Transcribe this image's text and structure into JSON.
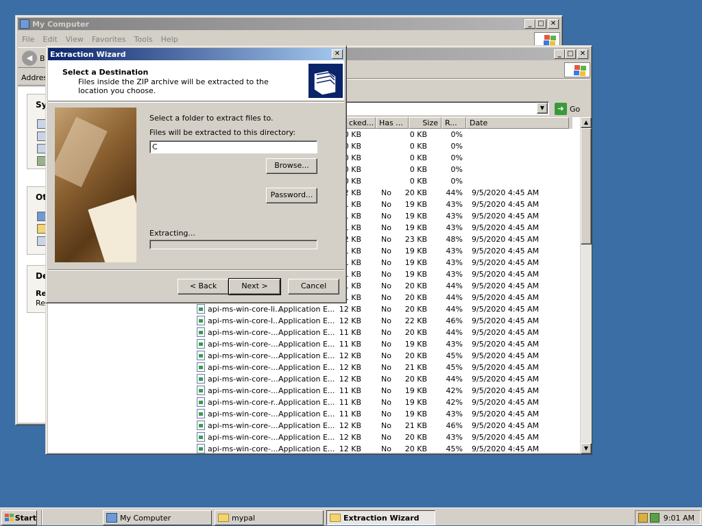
{
  "my_computer": {
    "title": "My Computer",
    "menu": [
      "File",
      "Edit",
      "View",
      "Favorites",
      "Tools",
      "Help"
    ],
    "back_label": "B",
    "address_label": "Addres",
    "panels": [
      {
        "title": "Sys"
      },
      {
        "title": "Oth"
      },
      {
        "title": "De",
        "detail_title": "Re",
        "detail_text": "Re"
      }
    ]
  },
  "zip_window": {
    "go_label": "Go",
    "columns": [
      "cked...",
      "Has ...",
      "Size",
      "R...",
      "Date"
    ],
    "rows": [
      {
        "name": "",
        "type": "",
        "packed": "0 KB",
        "pw": "",
        "size": "0 KB",
        "ratio": "0%",
        "date": ""
      },
      {
        "name": "",
        "type": "",
        "packed": "0 KB",
        "pw": "",
        "size": "0 KB",
        "ratio": "0%",
        "date": ""
      },
      {
        "name": "",
        "type": "",
        "packed": "0 KB",
        "pw": "",
        "size": "0 KB",
        "ratio": "0%",
        "date": ""
      },
      {
        "name": "",
        "type": "",
        "packed": "0 KB",
        "pw": "",
        "size": "0 KB",
        "ratio": "0%",
        "date": ""
      },
      {
        "name": "",
        "type": "",
        "packed": "0 KB",
        "pw": "",
        "size": "0 KB",
        "ratio": "0%",
        "date": ""
      },
      {
        "name": "",
        "type": "",
        "packed": "12 KB",
        "pw": "No",
        "size": "20 KB",
        "ratio": "44%",
        "date": "9/5/2020 4:45 AM"
      },
      {
        "name": "",
        "type": "",
        "packed": "11 KB",
        "pw": "No",
        "size": "19 KB",
        "ratio": "43%",
        "date": "9/5/2020 4:45 AM"
      },
      {
        "name": "",
        "type": "",
        "packed": "11 KB",
        "pw": "No",
        "size": "19 KB",
        "ratio": "43%",
        "date": "9/5/2020 4:45 AM"
      },
      {
        "name": "",
        "type": "",
        "packed": "11 KB",
        "pw": "No",
        "size": "19 KB",
        "ratio": "43%",
        "date": "9/5/2020 4:45 AM"
      },
      {
        "name": "",
        "type": "",
        "packed": "12 KB",
        "pw": "No",
        "size": "23 KB",
        "ratio": "48%",
        "date": "9/5/2020 4:45 AM"
      },
      {
        "name": "",
        "type": "",
        "packed": "11 KB",
        "pw": "No",
        "size": "19 KB",
        "ratio": "43%",
        "date": "9/5/2020 4:45 AM"
      },
      {
        "name": "",
        "type": "",
        "packed": "11 KB",
        "pw": "No",
        "size": "19 KB",
        "ratio": "43%",
        "date": "9/5/2020 4:45 AM"
      },
      {
        "name": "",
        "type": "",
        "packed": "11 KB",
        "pw": "No",
        "size": "19 KB",
        "ratio": "43%",
        "date": "9/5/2020 4:45 AM"
      },
      {
        "name": "",
        "type": "",
        "packed": "11 KB",
        "pw": "No",
        "size": "20 KB",
        "ratio": "44%",
        "date": "9/5/2020 4:45 AM"
      },
      {
        "name": "",
        "type": "",
        "packed": "11 KB",
        "pw": "No",
        "size": "20 KB",
        "ratio": "44%",
        "date": "9/5/2020 4:45 AM"
      },
      {
        "name": "api-ms-win-core-li...",
        "type": "Application E...",
        "packed": "12 KB",
        "pw": "No",
        "size": "20 KB",
        "ratio": "44%",
        "date": "9/5/2020 4:45 AM"
      },
      {
        "name": "api-ms-win-core-l...",
        "type": "Application E...",
        "packed": "12 KB",
        "pw": "No",
        "size": "22 KB",
        "ratio": "46%",
        "date": "9/5/2020 4:45 AM"
      },
      {
        "name": "api-ms-win-core-...",
        "type": "Application E...",
        "packed": "11 KB",
        "pw": "No",
        "size": "20 KB",
        "ratio": "44%",
        "date": "9/5/2020 4:45 AM"
      },
      {
        "name": "api-ms-win-core-...",
        "type": "Application E...",
        "packed": "11 KB",
        "pw": "No",
        "size": "19 KB",
        "ratio": "43%",
        "date": "9/5/2020 4:45 AM"
      },
      {
        "name": "api-ms-win-core-...",
        "type": "Application E...",
        "packed": "12 KB",
        "pw": "No",
        "size": "20 KB",
        "ratio": "45%",
        "date": "9/5/2020 4:45 AM"
      },
      {
        "name": "api-ms-win-core-...",
        "type": "Application E...",
        "packed": "12 KB",
        "pw": "No",
        "size": "21 KB",
        "ratio": "45%",
        "date": "9/5/2020 4:45 AM"
      },
      {
        "name": "api-ms-win-core-...",
        "type": "Application E...",
        "packed": "12 KB",
        "pw": "No",
        "size": "20 KB",
        "ratio": "44%",
        "date": "9/5/2020 4:45 AM"
      },
      {
        "name": "api-ms-win-core-...",
        "type": "Application E...",
        "packed": "11 KB",
        "pw": "No",
        "size": "19 KB",
        "ratio": "42%",
        "date": "9/5/2020 4:45 AM"
      },
      {
        "name": "api-ms-win-core-r...",
        "type": "Application E...",
        "packed": "11 KB",
        "pw": "No",
        "size": "19 KB",
        "ratio": "42%",
        "date": "9/5/2020 4:45 AM"
      },
      {
        "name": "api-ms-win-core-...",
        "type": "Application E...",
        "packed": "11 KB",
        "pw": "No",
        "size": "19 KB",
        "ratio": "43%",
        "date": "9/5/2020 4:45 AM"
      },
      {
        "name": "api-ms-win-core-...",
        "type": "Application E...",
        "packed": "12 KB",
        "pw": "No",
        "size": "21 KB",
        "ratio": "46%",
        "date": "9/5/2020 4:45 AM"
      },
      {
        "name": "api-ms-win-core-...",
        "type": "Application E...",
        "packed": "12 KB",
        "pw": "No",
        "size": "20 KB",
        "ratio": "43%",
        "date": "9/5/2020 4:45 AM"
      },
      {
        "name": "api-ms-win-core-...",
        "type": "Application E...",
        "packed": "12 KB",
        "pw": "No",
        "size": "20 KB",
        "ratio": "45%",
        "date": "9/5/2020 4:45 AM"
      }
    ]
  },
  "wizard": {
    "title": "Extraction Wizard",
    "heading": "Select a Destination",
    "subheading": "Files inside the ZIP archive will be extracted to the location you choose.",
    "select_label": "Select a folder to extract files to.",
    "dir_label": "Files will be extracted to this directory:",
    "dir_value": "C",
    "browse": "Browse...",
    "password": "Password...",
    "extracting": "Extracting...",
    "back": "< Back",
    "next": "Next >",
    "cancel": "Cancel",
    "progress": 0
  },
  "taskbar": {
    "start": "Start",
    "items": [
      "My Computer",
      "mypal",
      "Extraction Wizard"
    ],
    "time": "9:01 AM"
  },
  "colors": {
    "desktop": "#3a6ea5",
    "title_active": "#0a246a",
    "face": "#d4d0c8"
  }
}
